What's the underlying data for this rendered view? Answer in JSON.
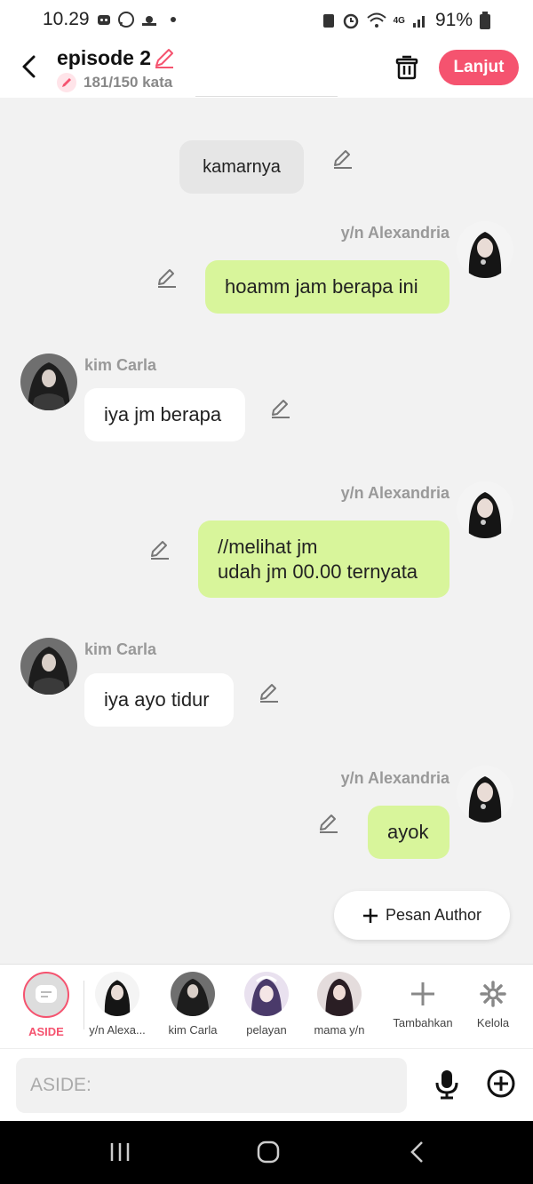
{
  "status_bar": {
    "time": "10.29",
    "battery": "91%",
    "network": "4G"
  },
  "header": {
    "title": "episode 2",
    "word_count": "181/150 kata",
    "next_button": "Lanjut"
  },
  "messages": [
    {
      "type": "narration",
      "text": "kamarnya"
    },
    {
      "type": "right",
      "speaker": "y/n Alexandria",
      "text": "hoamm jam berapa ini"
    },
    {
      "type": "left",
      "speaker": "kim Carla",
      "text": "iya jm berapa"
    },
    {
      "type": "right",
      "speaker": "y/n Alexandria",
      "line1": "//melihat jm",
      "line2": "udah jm 00.00 ternyata"
    },
    {
      "type": "left",
      "speaker": "kim Carla",
      "text": "iya ayo tidur"
    },
    {
      "type": "right",
      "speaker": "y/n Alexandria",
      "text": "ayok"
    }
  ],
  "pesan_author": "Pesan Author",
  "characters": [
    {
      "label": "ASIDE"
    },
    {
      "label": "y/n Alexa..."
    },
    {
      "label": "kim Carla"
    },
    {
      "label": "pelayan"
    },
    {
      "label": "mama y/n"
    },
    {
      "label": "Tambahkan"
    },
    {
      "label": "Kelola"
    }
  ],
  "input": {
    "placeholder": "ASIDE:"
  },
  "colors": {
    "accent": "#f5536f",
    "right_bubble": "#d8f59b",
    "left_bubble": "#ffffff",
    "narration_bubble": "#e6e6e6"
  }
}
